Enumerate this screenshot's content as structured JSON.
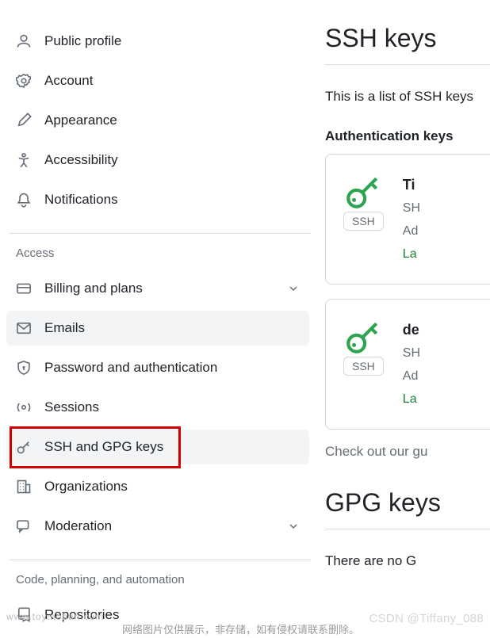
{
  "sidebar": {
    "top": [
      {
        "label": "Public profile",
        "icon": "person-icon"
      },
      {
        "label": "Account",
        "icon": "gear-icon"
      },
      {
        "label": "Appearance",
        "icon": "paintbrush-icon"
      },
      {
        "label": "Accessibility",
        "icon": "accessibility-icon"
      },
      {
        "label": "Notifications",
        "icon": "bell-icon"
      }
    ],
    "access_header": "Access",
    "access": [
      {
        "label": "Billing and plans",
        "icon": "credit-card-icon",
        "chev": true
      },
      {
        "label": "Emails",
        "icon": "mail-icon",
        "active": true
      },
      {
        "label": "Password and authentication",
        "icon": "shield-lock-icon"
      },
      {
        "label": "Sessions",
        "icon": "broadcast-icon"
      },
      {
        "label": "SSH and GPG keys",
        "icon": "key-icon",
        "active": true,
        "highlight": true
      },
      {
        "label": "Organizations",
        "icon": "organization-icon"
      },
      {
        "label": "Moderation",
        "icon": "comment-discussion-icon",
        "chev": true
      }
    ],
    "code_header": "Code, planning, and automation",
    "code": [
      {
        "label": "Repositories",
        "icon": "repo-icon"
      }
    ]
  },
  "main": {
    "ssh_heading": "SSH keys",
    "lead": "This is a list of SSH keys",
    "auth_heading": "Authentication keys",
    "badge": "SSH",
    "keys": [
      {
        "title": "Ti",
        "sha": "SH",
        "addr": "Ad",
        "last": "La"
      },
      {
        "title": "de",
        "sha": "SH",
        "addr": "Ad",
        "last": "La"
      }
    ],
    "checkout": "Check out our gu",
    "gpg_heading": "GPG keys",
    "gpg_line": "There are no G"
  },
  "footer": {
    "site": "www.toymoban.com",
    "note": "网络图片仅供展示，非存储，如有侵权请联系删除。",
    "wm": "CSDN @Tiffany_088"
  },
  "colors": {
    "green": "#2da44e"
  }
}
